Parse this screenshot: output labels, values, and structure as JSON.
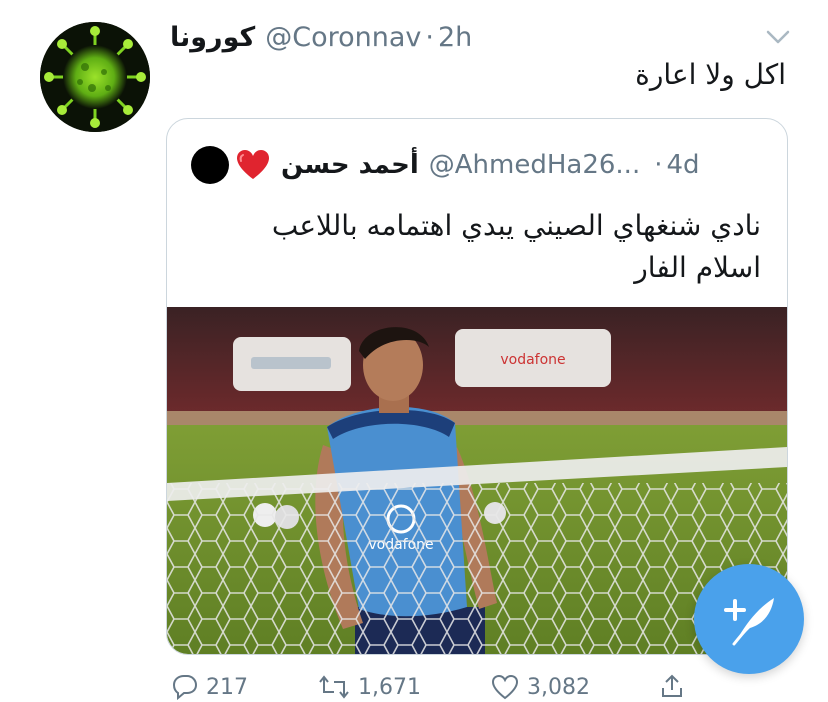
{
  "tweet": {
    "author_name": "كورونا",
    "author_handle": "@Coronnav",
    "separator": "·",
    "time": "2h",
    "text": "اكل ولا اعارة",
    "avatar_icon": "coronavirus-avatar"
  },
  "quoted": {
    "author_name": "أحمد حسن",
    "author_handle": "@AhmedHa26...",
    "separator": "·",
    "time": "4d",
    "text_line1": "نادي شنغهاي الصيني يبدي اهتمامه باللاعب",
    "text_line2": "اسلام الفار",
    "media_text": "vodafone",
    "emoji_icon": "red-heart-icon"
  },
  "actions": {
    "replies": "217",
    "retweets": "1,671",
    "likes": "3,082"
  },
  "colors": {
    "accent": "#4aa1eb",
    "muted": "#657786",
    "border": "#ccd6dd"
  }
}
